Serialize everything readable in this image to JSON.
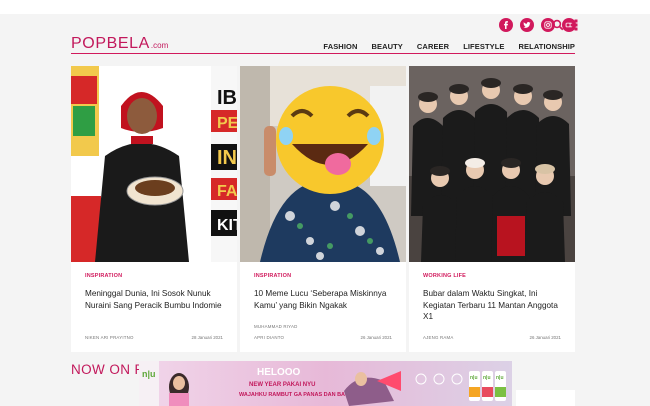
{
  "header": {
    "logo": "POPBELA",
    "logo_suffix": ".com",
    "nav": [
      "FASHION",
      "BEAUTY",
      "CAREER",
      "LIFESTYLE",
      "RELATIONSHIP"
    ]
  },
  "icons": {
    "social": [
      "facebook-icon",
      "twitter-icon",
      "instagram-icon",
      "youtube-icon"
    ],
    "search": "search-icon",
    "apps": "grid-menu-icon"
  },
  "colors": {
    "brand": "#d1195c",
    "logo": "#c2185b"
  },
  "articles": [
    {
      "category": "INSPIRATION",
      "title": "Meninggal Dunia, Ini Sosok Nunuk Nuraini Sang Peracik Bumbu Indomie",
      "author": "NIKEN ARI PRAYITNO",
      "date": "28 Januari 2021",
      "image_text": [
        "IB",
        "PENE",
        "INDO",
        "FA",
        "KITA"
      ]
    },
    {
      "category": "INSPIRATION",
      "title": "10 Meme Lucu ‘Seberapa Miskinnya Kamu’ yang Bikin Ngakak",
      "author": "MUHAMMAD RIYAD",
      "author2": "APRI DIANTO",
      "date": "26 Januari 2021"
    },
    {
      "category": "WORKING LIFE",
      "title": "Bubar dalam Waktu Singkat, Ini Kegiatan Terbaru 11 Mantan Anggota X1",
      "author": "AJENG RAMA",
      "date": "26 Januari 2021"
    }
  ],
  "section": {
    "title": "NOW ON P"
  },
  "banner": {
    "brand": "n|u",
    "headline": "HELOOO",
    "line1": "NEW YEAR PAKAI NYU",
    "line2": "WAJAHKU RAMBUT GA PANAS DAN BAU AC",
    "products": [
      "n|u",
      "n|u",
      "n|u"
    ]
  }
}
